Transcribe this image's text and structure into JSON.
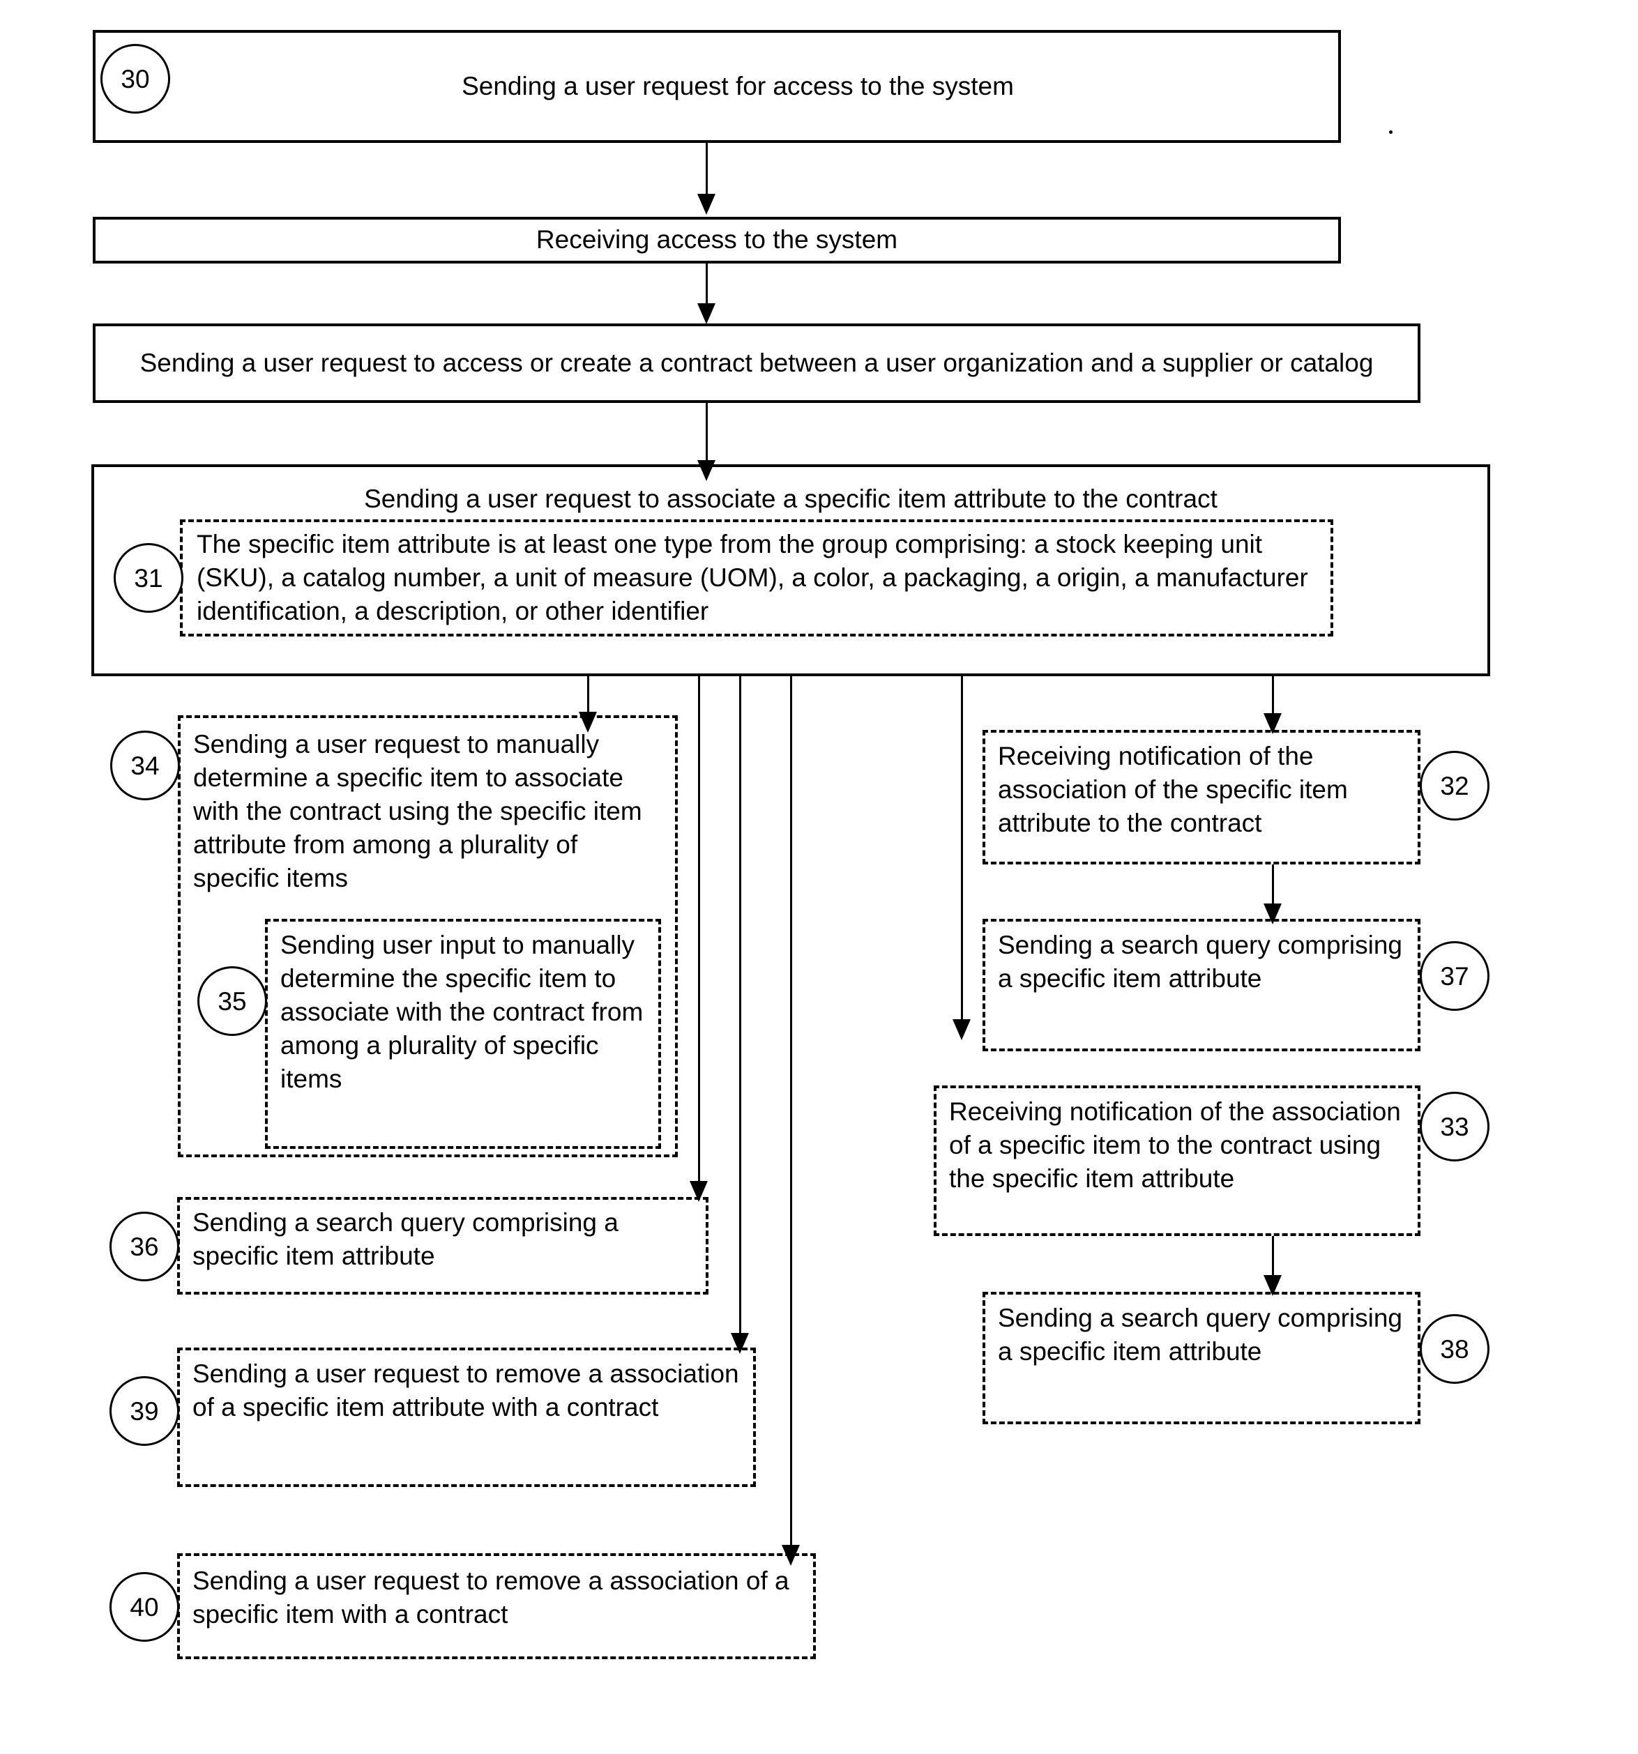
{
  "figure": {
    "type": "patent-flowchart",
    "orientation": "portrait"
  },
  "steps": [
    {
      "ref": "30",
      "text": "Sending a user request for access to the system",
      "style": "solid"
    },
    {
      "ref": "",
      "text": "Receiving access to the system",
      "style": "solid"
    },
    {
      "ref": "",
      "text": "Sending a user request to access or create a contract between a user organization and a supplier or catalog",
      "style": "solid"
    },
    {
      "ref": "",
      "text": "Sending a user request to associate a specific item attribute to the contract",
      "style": "solid"
    },
    {
      "ref": "31",
      "text": "The specific item attribute is at least one type from the group comprising: a stock keeping unit (SKU), a catalog number, a unit of measure (UOM), a color, a packaging, a origin, a manufacturer identification, a description, or other identifier",
      "style": "dashed"
    },
    {
      "ref": "34",
      "text": "Sending a user request to manually determine a specific item to associate with the contract using the specific item attribute from among a plurality of specific items",
      "style": "dashed"
    },
    {
      "ref": "35",
      "text": "Sending user input to manually determine the specific item to associate with the contract from among a plurality of specific items",
      "style": "dashed"
    },
    {
      "ref": "36",
      "text": "Sending a search query comprising a specific item attribute",
      "style": "dashed"
    },
    {
      "ref": "39",
      "text": "Sending a user request to remove a association of a specific item attribute with a contract",
      "style": "dashed"
    },
    {
      "ref": "40",
      "text": "Sending a user request to remove a association of a specific item with a contract",
      "style": "dashed"
    },
    {
      "ref": "32",
      "text": "Receiving notification of the association of the specific item attribute to the contract",
      "style": "dashed"
    },
    {
      "ref": "37",
      "text": "Sending a search query comprising a specific item attribute",
      "style": "dashed"
    },
    {
      "ref": "33",
      "text": "Receiving notification of the association of a specific item to the contract using the specific item attribute",
      "style": "dashed"
    },
    {
      "ref": "38",
      "text": "Sending a search query comprising a specific item attribute",
      "style": "dashed"
    }
  ],
  "labels": {
    "ref_30": "30",
    "ref_31": "31",
    "ref_32": "32",
    "ref_33": "33",
    "ref_34": "34",
    "ref_35": "35",
    "ref_36": "36",
    "ref_37": "37",
    "ref_38": "38",
    "ref_39": "39",
    "ref_40": "40"
  }
}
